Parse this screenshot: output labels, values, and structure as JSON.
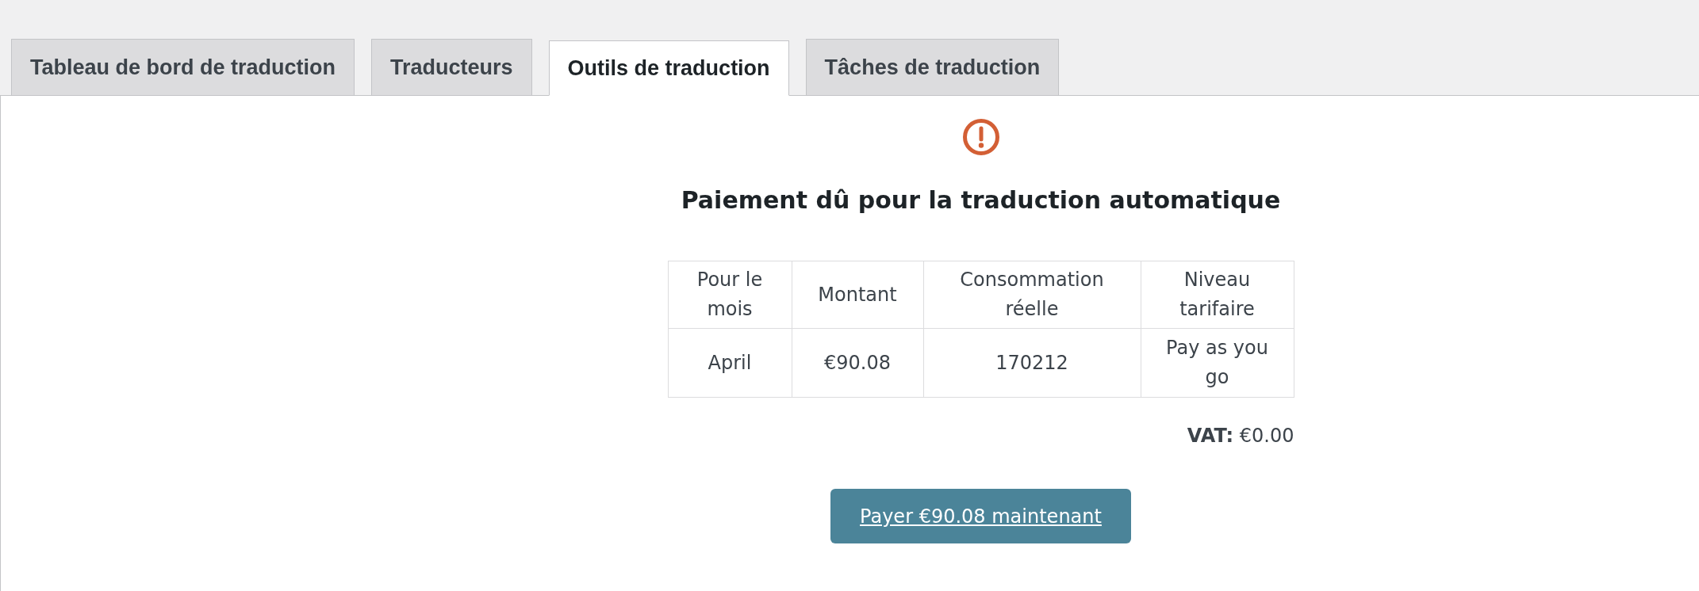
{
  "tabs": [
    {
      "label": "Tableau de bord de traduction",
      "selected": false
    },
    {
      "label": "Traducteurs",
      "selected": false
    },
    {
      "label": "Outils de traduction",
      "selected": true
    },
    {
      "label": "Tâches de traduction",
      "selected": false
    }
  ],
  "notice": {
    "title": "Paiement dû pour la traduction automatique",
    "table": {
      "columns": [
        "Pour le mois",
        "Montant",
        "Consommation réelle",
        "Niveau tarifaire"
      ],
      "rows": [
        [
          "April",
          "€90.08",
          "170212",
          "Pay as you go"
        ]
      ]
    },
    "vat": "**VAT:** €0.00",
    "pay_button": "Payer €90.08 maintenant"
  }
}
